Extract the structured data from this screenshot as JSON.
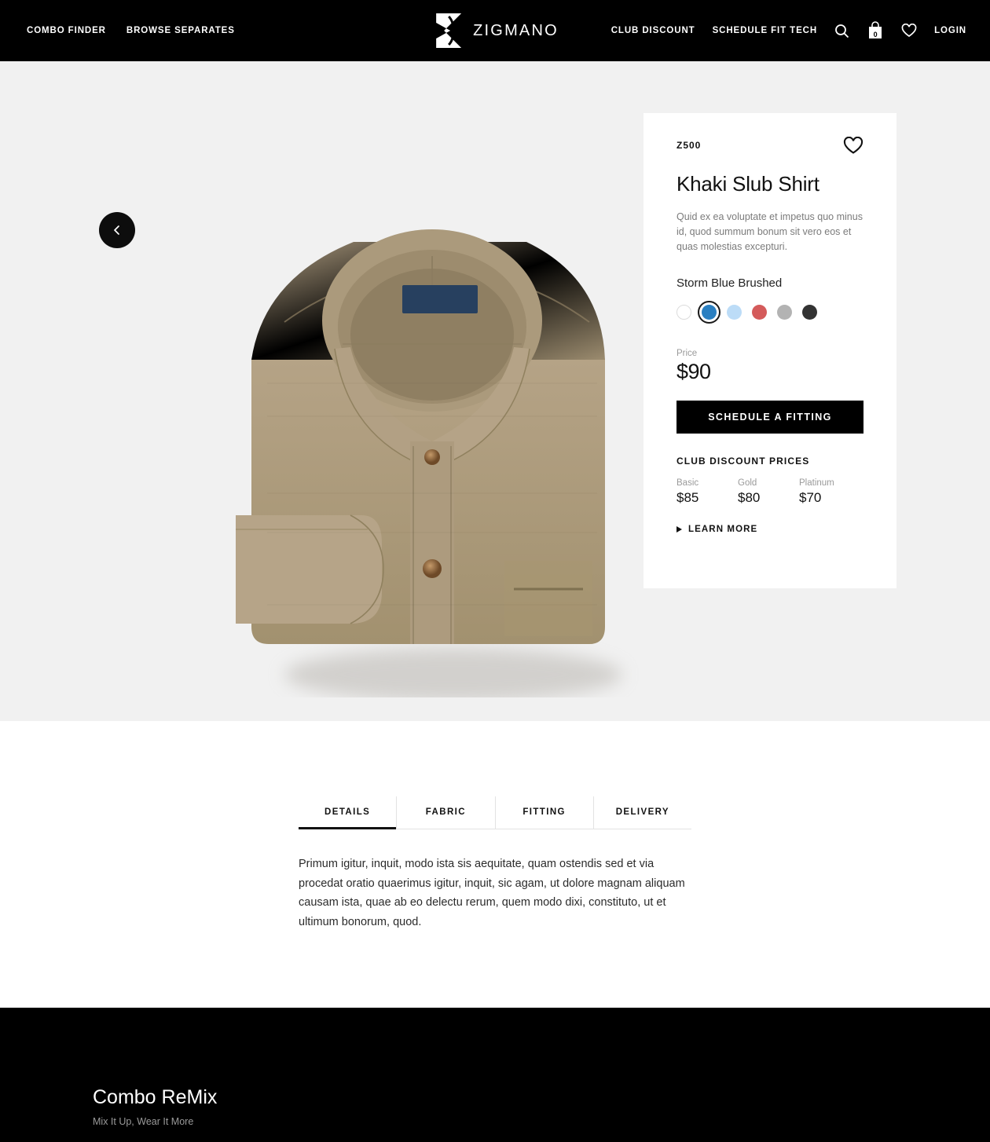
{
  "header": {
    "left_nav": [
      {
        "label": "COMBO FINDER"
      },
      {
        "label": "BROWSE SEPARATES"
      }
    ],
    "logo": {
      "text": "ZIGMANO",
      "mark": "z-logo-icon"
    },
    "right_nav": [
      {
        "label": "CLUB DISCOUNT"
      },
      {
        "label": "SCHEDULE FIT TECH"
      }
    ],
    "icons": {
      "search": "search-icon",
      "bag": "shopping-bag-icon",
      "bag_count": "0",
      "wishlist": "heart-icon"
    },
    "login_label": "LOGIN",
    "background": "#000000"
  },
  "hero": {
    "background": "#f1f1f1",
    "prev_button": "chevron-left-icon",
    "product_image_alt": "folded khaki slub shirt"
  },
  "product": {
    "sku": "Z500",
    "title": "Khaki Slub Shirt",
    "description": "Quid ex ea voluptate et impetus quo minus id, quod summum bonum sit vero eos et quas molestias excepturi.",
    "wishlist_icon": "heart-icon",
    "color_name": "Storm Blue Brushed",
    "swatches": [
      {
        "name": "white",
        "hex": "#ffffff",
        "selected": false
      },
      {
        "name": "storm-blue",
        "hex": "#2a7fc1",
        "selected": true
      },
      {
        "name": "light-blue",
        "hex": "#bcdcf7",
        "selected": false
      },
      {
        "name": "red",
        "hex": "#d45b5b",
        "selected": false
      },
      {
        "name": "grey",
        "hex": "#b3b3b3",
        "selected": false
      },
      {
        "name": "charcoal",
        "hex": "#333333",
        "selected": false
      }
    ],
    "price_label": "Price",
    "price": "$90",
    "cta_label": "SCHEDULE A FITTING",
    "club": {
      "title": "CLUB DISCOUNT PRICES",
      "tiers": [
        {
          "name": "Basic",
          "price": "$85"
        },
        {
          "name": "Gold",
          "price": "$80"
        },
        {
          "name": "Platinum",
          "price": "$70"
        }
      ],
      "learn_more": "LEARN MORE"
    }
  },
  "tabs": {
    "items": [
      {
        "label": "DETAILS",
        "active": true
      },
      {
        "label": "FABRIC",
        "active": false
      },
      {
        "label": "FITTING",
        "active": false
      },
      {
        "label": "DELIVERY",
        "active": false
      }
    ],
    "body": "Primum igitur, inquit, modo ista sis aequitate, quam ostendis sed et via procedat oratio quaerimus igitur, inquit, sic agam, ut dolore magnam aliquam causam ista, quae ab eo delectu rerum, quem modo dixi, constituto, ut et ultimum bonorum, quod."
  },
  "footer": {
    "title": "Combo ReMix",
    "subtitle": "Mix It Up, Wear It More",
    "background": "#000000"
  }
}
